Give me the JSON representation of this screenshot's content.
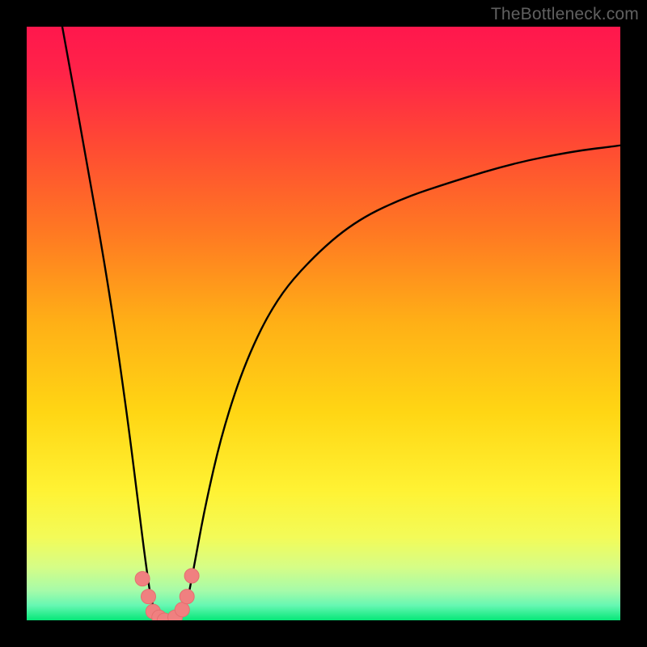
{
  "watermark": "TheBottleneck.com",
  "colors": {
    "frame": "#000000",
    "watermark": "#606060",
    "curve": "#000000",
    "dot_fill": "#f08080",
    "dot_stroke": "#e46f6f",
    "gradient_stops": [
      {
        "offset": 0.0,
        "color": "#ff174d"
      },
      {
        "offset": 0.08,
        "color": "#ff2448"
      },
      {
        "offset": 0.2,
        "color": "#ff4a33"
      },
      {
        "offset": 0.35,
        "color": "#ff7a22"
      },
      {
        "offset": 0.5,
        "color": "#ffb016"
      },
      {
        "offset": 0.65,
        "color": "#ffd614"
      },
      {
        "offset": 0.78,
        "color": "#fff233"
      },
      {
        "offset": 0.86,
        "color": "#f3fb58"
      },
      {
        "offset": 0.91,
        "color": "#d6fd86"
      },
      {
        "offset": 0.95,
        "color": "#a6fba9"
      },
      {
        "offset": 0.975,
        "color": "#66f7b2"
      },
      {
        "offset": 1.0,
        "color": "#06e778"
      }
    ]
  },
  "chart_data": {
    "type": "line",
    "title": "",
    "xlabel": "",
    "ylabel": "",
    "xlim": [
      0,
      100
    ],
    "ylim": [
      0,
      100
    ],
    "note": "Axes are unlabeled; x/y normalized 0–100. Curve depicts a bottleneck-style dip: value drops from ~100 at x≈6 to ~0 near x≈21–26 (flat minimum), then rises asymptotically toward ~80 at x≈100.",
    "series": [
      {
        "name": "bottleneck-curve",
        "x": [
          6,
          10,
          14,
          17,
          19,
          20,
          21,
          22,
          23,
          24,
          25,
          26,
          27,
          28,
          30,
          33,
          37,
          42,
          48,
          55,
          63,
          72,
          82,
          92,
          100
        ],
        "y": [
          100,
          78,
          55,
          34,
          18,
          10,
          3,
          1,
          0,
          0,
          0,
          1,
          3,
          8,
          19,
          32,
          44,
          54,
          61,
          67,
          71,
          74,
          77,
          79,
          80
        ]
      }
    ],
    "highlight_points": {
      "name": "minimum-dots",
      "x": [
        19.5,
        20.5,
        21.3,
        22.3,
        23.2,
        25.0,
        26.2,
        27.0,
        27.8
      ],
      "y": [
        7.0,
        4.0,
        1.5,
        0.5,
        0.0,
        0.5,
        1.8,
        4.0,
        7.5
      ]
    }
  }
}
